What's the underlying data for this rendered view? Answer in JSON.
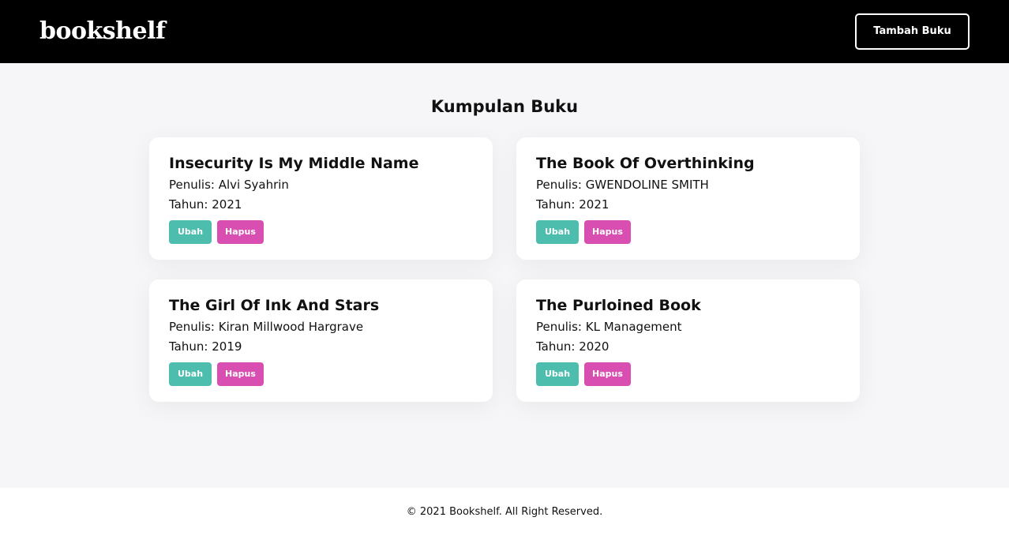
{
  "navbar": {
    "brand": "bookshelf",
    "add_button_label": "Tambah Buku"
  },
  "main": {
    "title": "Kumpulan Buku",
    "books": [
      {
        "title": "Insecurity Is My Middle Name",
        "author_label": "Penulis:",
        "author": "Alvi Syahrin",
        "year_label": "Tahun:",
        "year": "2021",
        "edit_label": "Ubah",
        "delete_label": "Hapus"
      },
      {
        "title": "The Book Of Overthinking",
        "author_label": "Penulis:",
        "author": "GWENDOLINE SMITH",
        "year_label": "Tahun:",
        "year": "2021",
        "edit_label": "Ubah",
        "delete_label": "Hapus"
      },
      {
        "title": "The Girl Of Ink And Stars",
        "author_label": "Penulis:",
        "author": "Kiran Millwood Hargrave",
        "year_label": "Tahun:",
        "year": "2019",
        "edit_label": "Ubah",
        "delete_label": "Hapus"
      },
      {
        "title": "The Purloined Book",
        "author_label": "Penulis:",
        "author": "KL Management",
        "year_label": "Tahun:",
        "year": "2020",
        "edit_label": "Ubah",
        "delete_label": "Hapus"
      }
    ]
  },
  "footer": {
    "text": "© 2021 Bookshelf. All Right Reserved."
  },
  "colors": {
    "navbar_bg": "#000000",
    "page_bg": "#f6f6f8",
    "edit_button": "#4dbdad",
    "delete_button": "#d94fb1"
  }
}
